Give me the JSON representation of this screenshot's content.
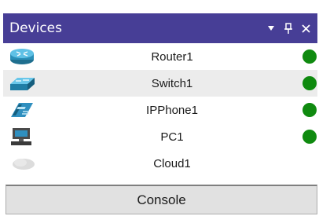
{
  "panel": {
    "title": "Devices",
    "controls": [
      {
        "icon": "dropdown-arrow-icon",
        "glyph": "▾"
      },
      {
        "icon": "pin-icon",
        "glyph": "ᚔ"
      },
      {
        "icon": "close-icon",
        "glyph": "✕"
      }
    ],
    "title_bar_color": "#473e96"
  },
  "devices": [
    {
      "name": "Router1",
      "icon": "router-icon",
      "status": "online",
      "status_color": "#0f8a0f"
    },
    {
      "name": "Switch1",
      "icon": "switch-icon",
      "status": "online",
      "status_color": "#0f8a0f"
    },
    {
      "name": "IPPhone1",
      "icon": "ip-phone-icon",
      "status": "online",
      "status_color": "#0f8a0f"
    },
    {
      "name": "PC1",
      "icon": "pc-icon",
      "status": "online",
      "status_color": "#0f8a0f"
    },
    {
      "name": "Cloud1",
      "icon": "cloud-icon",
      "status": "none",
      "status_color": ""
    }
  ],
  "console": {
    "label": "Console"
  }
}
